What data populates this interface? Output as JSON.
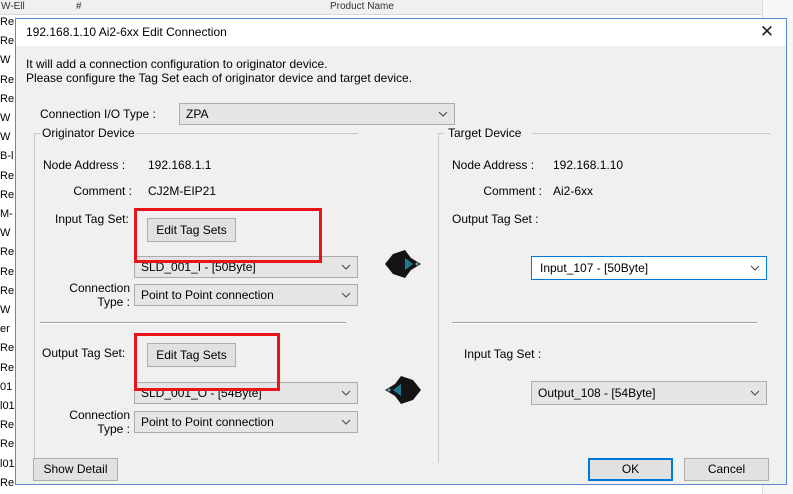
{
  "background": {
    "header_cols": [
      "W-Ell",
      "#",
      "Product Name"
    ],
    "row_labels": [
      "Re",
      "Re",
      "W",
      "Re",
      "Re",
      "W",
      "W",
      "B-l",
      "Re",
      "Re",
      "M-",
      "W",
      "Re",
      "Re",
      "Re",
      "W",
      "er",
      "Re",
      "Re",
      "01",
      "l01",
      "Re",
      "Re",
      "l01",
      "Re"
    ]
  },
  "dialog": {
    "title": "192.168.1.10 Ai2-6xx   Edit Connection",
    "close_glyph": "✕",
    "intro_line1": "It will add a connection configuration to originator device.",
    "intro_line2": "Please configure the Tag Set each of originator device and target device.",
    "connection_io_type_label": "Connection I/O Type :",
    "connection_io_type_value": "ZPA",
    "originator": {
      "group_label": "Originator Device",
      "node_address_label": "Node Address :",
      "node_address_value": "192.168.1.1",
      "comment_label": "Comment :",
      "comment_value": "CJ2M-EIP21",
      "input_tag_set_label": "Input Tag Set:",
      "input_edit_button": "Edit Tag Sets",
      "input_tag_value": "SLD_001_I - [50Byte]",
      "input_connection_type_label_1": "Connection",
      "input_connection_type_label_2": "Type :",
      "input_connection_type_value": "Point to Point connection",
      "output_tag_set_label": "Output Tag Set:",
      "output_edit_button": "Edit Tag Sets",
      "output_tag_value": "SLD_001_O - [54Byte]",
      "output_connection_type_label_1": "Connection",
      "output_connection_type_label_2": "Type :",
      "output_connection_type_value": "Point to Point connection"
    },
    "target": {
      "group_label": "Target Device",
      "node_address_label": "Node Address :",
      "node_address_value": "192.168.1.10",
      "comment_label": "Comment :",
      "comment_value": "Ai2-6xx",
      "output_tag_set_label": "Output Tag Set :",
      "output_tag_value": "Input_107 - [50Byte]",
      "input_tag_set_label": "Input Tag Set :",
      "input_tag_value": "Output_108 - [54Byte]"
    },
    "show_detail_button": "Show Detail",
    "ok_button": "OK",
    "cancel_button": "Cancel"
  },
  "colors": {
    "highlight_box": "#e8141a",
    "dialog_border": "#5a8bd0",
    "focus_blue": "#0078d7"
  },
  "icons": [
    "close-icon",
    "dropdown-arrow-icon",
    "arrow-right-icon",
    "arrow-left-icon"
  ]
}
